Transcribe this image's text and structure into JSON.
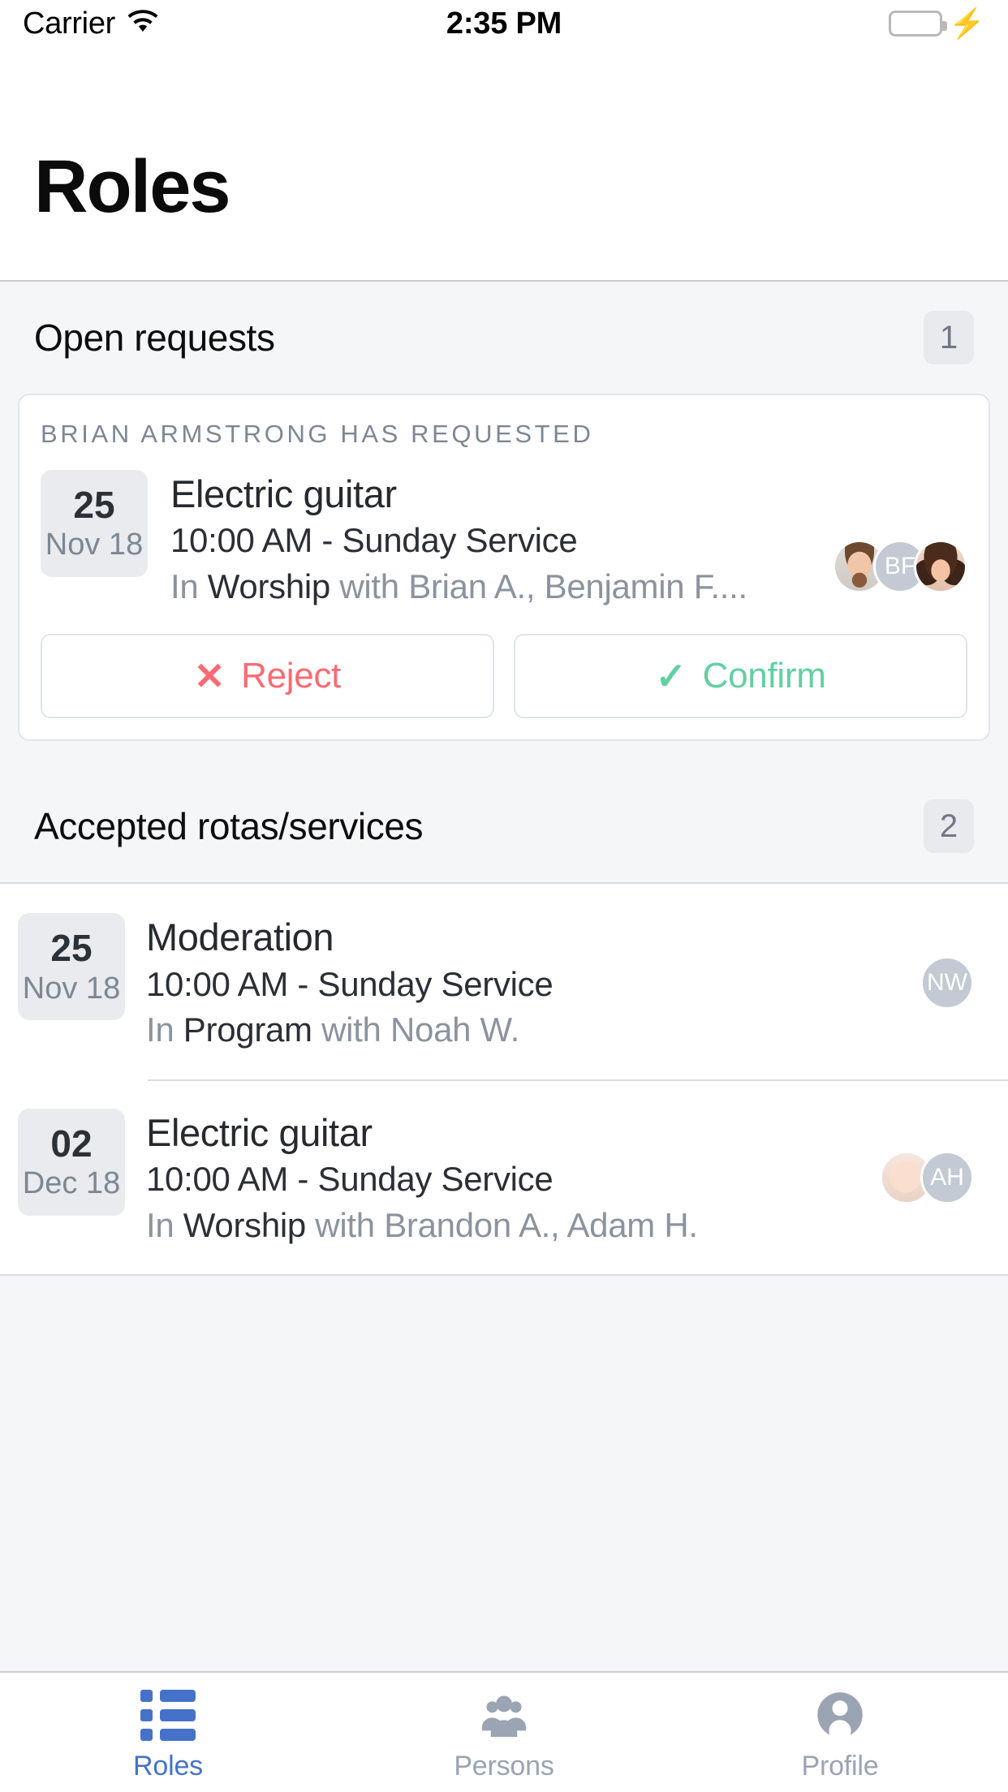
{
  "status_bar": {
    "carrier": "Carrier",
    "wifi_icon": "wifi-icon",
    "time": "2:35 PM",
    "battery_icon": "battery-full-icon",
    "charging_icon": "lightning-bolt-icon",
    "battery_color": "#4CD964"
  },
  "nav": {
    "title": "Roles"
  },
  "open_requests": {
    "heading": "Open requests",
    "count": "1",
    "card": {
      "kicker": "BRIAN ARMSTRONG HAS REQUESTED",
      "date_day": "25",
      "date_month": "Nov 18",
      "title": "Electric guitar",
      "subtitle": "10:00 AM - Sunday Service",
      "meta_prefix": "In ",
      "meta_team": "Worship",
      "meta_suffix": " with Brian A., Benjamin F....",
      "avatars": [
        {
          "type": "photo",
          "name": "brian-armstrong-avatar",
          "style": "ph-man",
          "initials": ""
        },
        {
          "type": "initials",
          "name": "benjamin-f-avatar",
          "style": "",
          "initials": "BF"
        },
        {
          "type": "photo",
          "name": "third-member-avatar",
          "style": "ph-woman",
          "initials": ""
        }
      ],
      "reject_label": "Reject",
      "reject_icon": "cross-icon",
      "reject_color": "#fb6a72",
      "confirm_label": "Confirm",
      "confirm_icon": "check-icon",
      "confirm_color": "#63cfa2"
    }
  },
  "accepted": {
    "heading": "Accepted rotas/services",
    "count": "2",
    "rows": [
      {
        "date_day": "25",
        "date_month": "Nov 18",
        "title": "Moderation",
        "subtitle": "10:00 AM - Sunday Service",
        "meta_prefix": "In ",
        "meta_team": "Program",
        "meta_suffix": " with Noah W.",
        "avatars": [
          {
            "type": "initials",
            "name": "noah-w-avatar",
            "style": "",
            "initials": "NW"
          }
        ]
      },
      {
        "date_day": "02",
        "date_month": "Dec 18",
        "title": "Electric guitar",
        "subtitle": "10:00 AM - Sunday Service",
        "meta_prefix": "In ",
        "meta_team": "Worship",
        "meta_suffix": " with Brandon A., Adam H.",
        "avatars": [
          {
            "type": "photo",
            "name": "brandon-a-avatar",
            "style": "ph-baby",
            "initials": ""
          },
          {
            "type": "initials",
            "name": "adam-h-avatar",
            "style": "",
            "initials": "AH"
          }
        ]
      }
    ]
  },
  "tabbar": {
    "active_color": "#4572c8",
    "idle_color": "#9aa4b2",
    "tabs": [
      {
        "label": "Roles",
        "icon": "list-icon",
        "active": true
      },
      {
        "label": "Persons",
        "icon": "people-icon",
        "active": false
      },
      {
        "label": "Profile",
        "icon": "person-circle-icon",
        "active": false
      }
    ]
  }
}
